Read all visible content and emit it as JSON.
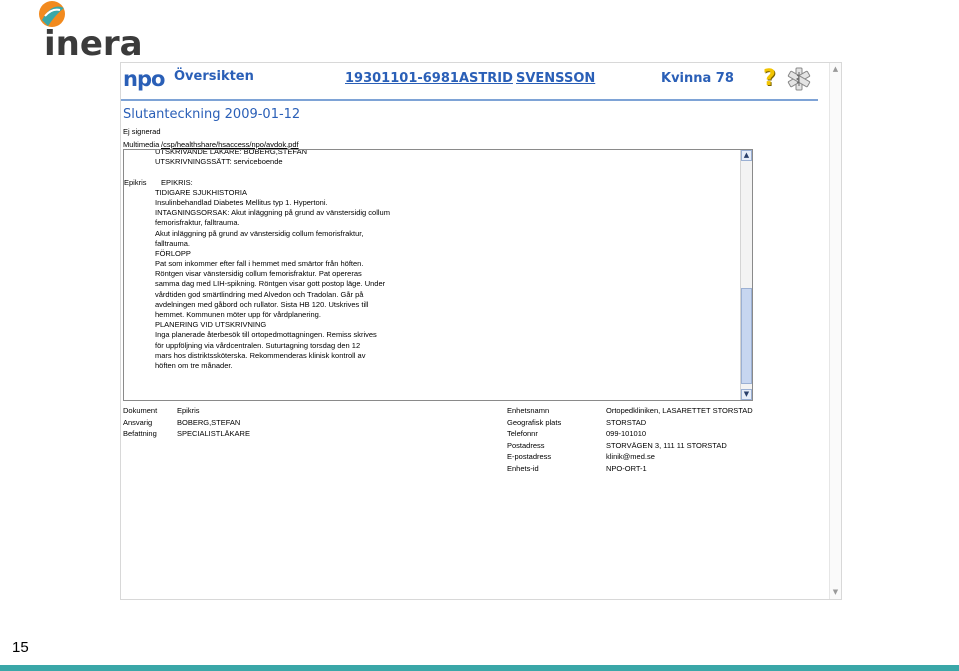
{
  "brand": {
    "logo_text": "inera",
    "app_logo_text": "npo"
  },
  "header": {
    "nav_label": "Översikten",
    "patient_id": "19301101-6981",
    "first_name": "ASTRID",
    "last_name": "SVENSSON",
    "gender_age": "Kvinna 78",
    "help_icon": "?",
    "icons": [
      "help-icon",
      "medical-star-icon"
    ]
  },
  "note": {
    "title": "Slutanteckning 2009-01-12",
    "status": "Ej signerad",
    "multimedia_label": "Multimedia",
    "multimedia_link": "/csp/healthshare/hsaccess/npo/avdok.pdf"
  },
  "text_rows": [
    {
      "key": "",
      "val": "UTSKRIVANDE LÄKARE: BOBERG,STEFAN"
    },
    {
      "key": "",
      "val": "UTSKRIVNINGSSÄTT: serviceboende"
    },
    {
      "key": "",
      "val": ""
    },
    {
      "key": "Epikris",
      "val": "EPIKRIS:"
    },
    {
      "key": "",
      "val": "TIDIGARE SJUKHISTORIA"
    },
    {
      "key": "",
      "val": "Insulinbehandlad Diabetes Mellitus typ 1. Hypertoni."
    },
    {
      "key": "",
      "val": "INTAGNINGSORSAK: Akut inläggning på grund av vänstersidig collum"
    },
    {
      "key": "",
      "val": "femorisfraktur, falltrauma."
    },
    {
      "key": "",
      "val": "Akut inläggning på grund av vänstersidig collum femorisfraktur,"
    },
    {
      "key": "",
      "val": "falltrauma."
    },
    {
      "key": "",
      "val": "FÖRLOPP"
    },
    {
      "key": "",
      "val": "Pat som inkommer efter fall i hemmet med smärtor från höften."
    },
    {
      "key": "",
      "val": "Röntgen visar vänstersidig collum femorisfraktur. Pat opereras"
    },
    {
      "key": "",
      "val": "samma dag med LIH-spikning. Röntgen visar gott postop läge. Under"
    },
    {
      "key": "",
      "val": "vårdtiden god smärtlindring med Alvedon och Tradolan. Går på"
    },
    {
      "key": "",
      "val": "avdelningen med gåbord och rullator. Sista HB 120. Utskrives till"
    },
    {
      "key": "",
      "val": "hemmet. Kommunen möter upp för vårdplanering."
    },
    {
      "key": "",
      "val": "PLANERING VID UTSKRIVNING"
    },
    {
      "key": "",
      "val": "Inga planerade återbesök till ortopedmottagningen. Remiss skrives"
    },
    {
      "key": "",
      "val": "för uppföljning via vårdcentralen. Suturtagning torsdag den 12"
    },
    {
      "key": "",
      "val": "mars hos distriktssköterska. Rekommenderas klinisk kontroll av"
    },
    {
      "key": "",
      "val": "höften om tre månader."
    }
  ],
  "document_meta_left": {
    "keys": [
      "Dokument",
      "Ansvarig",
      "Befattning"
    ],
    "values": [
      "Epikris",
      "BOBERG,STEFAN",
      "SPECIALISTLÄKARE"
    ]
  },
  "document_meta_right": {
    "keys": [
      "Enhetsnamn",
      "Geografisk plats",
      "Telefonnr",
      "Postadress",
      "E-postadress",
      "Enhets-id"
    ],
    "values": [
      "Ortopedkliniken, LASARETTET STORSTAD",
      "STORSTAD",
      "099-101010",
      "STORVÄGEN 3, 111 11 STORSTAD",
      "klinik@med.se",
      "NPO-ORT-1"
    ]
  },
  "slide": {
    "number": "15"
  },
  "colors": {
    "link_blue": "#2a5fb7",
    "accent_teal": "#3aa7a8",
    "logo_orange": "#f28a1e"
  }
}
